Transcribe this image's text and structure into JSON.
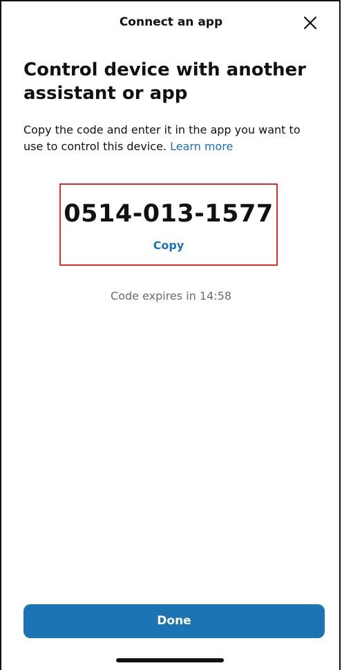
{
  "header": {
    "title": "Connect an app",
    "close_icon": "close-icon"
  },
  "main": {
    "heading": "Control device with another assistant or app",
    "description": "Copy the code and enter it in the app you want to use to control this device.",
    "learn_more_label": "Learn more",
    "code": "0514-013-1577",
    "copy_label": "Copy",
    "expires_text": "Code expires in 14:58"
  },
  "footer": {
    "done_label": "Done"
  },
  "colors": {
    "accent": "#1b74b4",
    "link": "#1a73b8",
    "highlight_border": "#e32b2b",
    "muted_text": "#6b6b6b"
  }
}
